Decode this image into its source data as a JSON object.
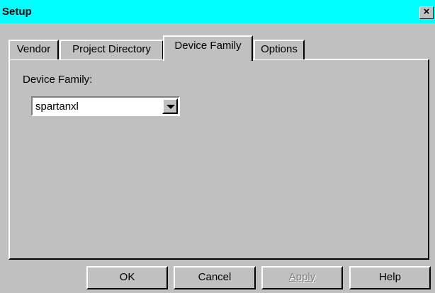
{
  "window": {
    "title": "Setup",
    "close_label": "×"
  },
  "tabs": [
    {
      "label": "Vendor",
      "active": false
    },
    {
      "label": "Project Directory",
      "active": false
    },
    {
      "label": "Device Family",
      "active": true
    },
    {
      "label": "Options",
      "active": false
    }
  ],
  "device_family": {
    "label": "Device Family:",
    "selected_value": "spartanxl"
  },
  "buttons": {
    "ok": "OK",
    "cancel": "Cancel",
    "apply": "Apply",
    "apply_disabled": true,
    "help": "Help"
  },
  "colors": {
    "titlebar": "#00ffff",
    "face": "#c0c0c0"
  }
}
